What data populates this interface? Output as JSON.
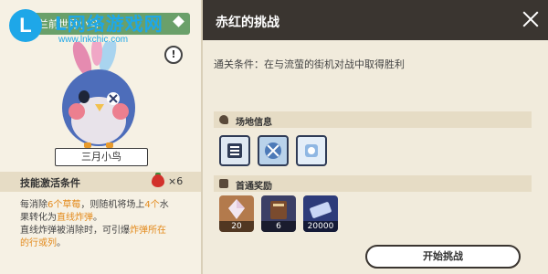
{
  "watermark": {
    "logo": "L",
    "title": "L网络游戏网",
    "url": "www.lnkchic.com"
  },
  "character": {
    "banner_label": "兰前世月小鸟",
    "name": "三月小鸟",
    "info_icon": "exclamation-icon"
  },
  "skill": {
    "title": "技能激活条件",
    "cost_count": "×6",
    "line1_a": "每消除",
    "line1_hl1": "6个草莓",
    "line1_b": "，则随机将场上",
    "line1_hl2": "4个",
    "line1_c": "水",
    "line2_a": "果转化为",
    "line2_hl": "直线炸弹",
    "line2_b": "。",
    "line3_a": "直线炸弹被消除时，可引爆",
    "line3_hl": "炸弹所在",
    "line4_hl": "的行或列",
    "line4_b": "。"
  },
  "panel": {
    "title": "赤红的挑战",
    "clear_condition": "通关条件：在与流萤的街机对战中取得胜利",
    "venue_label": "场地信息",
    "reward_label": "首通奖励",
    "rewards": [
      {
        "count": "20"
      },
      {
        "count": "6"
      },
      {
        "count": "20000"
      }
    ],
    "start_button": "开始挑战"
  },
  "colors": {
    "highlight": "#e38a1c",
    "banner": "#6aa06a",
    "panel_bg": "#f1ebdc"
  }
}
